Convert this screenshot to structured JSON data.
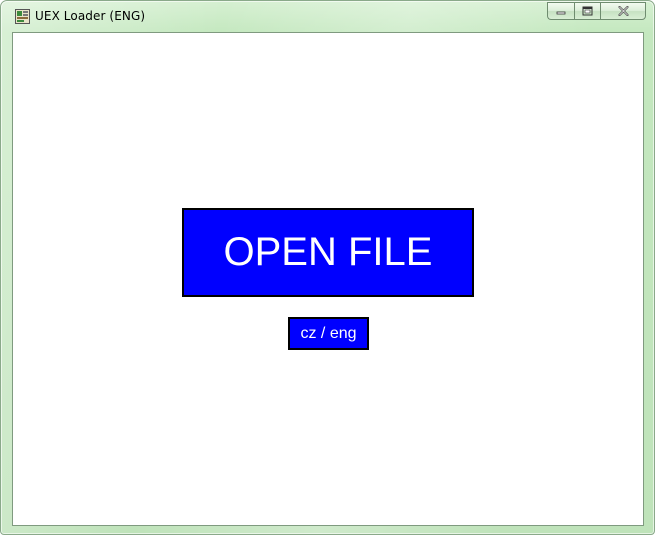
{
  "window": {
    "title": "UEX Loader (ENG)",
    "controls": {
      "minimize": "minimize-icon",
      "maximize": "restore-icon",
      "close": "close-icon"
    }
  },
  "main": {
    "open_file_label": "OPEN FILE",
    "language_toggle_label": "cz / eng"
  },
  "colors": {
    "button_background": "#0000ff",
    "button_text": "#ffffff",
    "button_border": "#000000",
    "frame": "#c4e8bf",
    "client_background": "#ffffff"
  }
}
